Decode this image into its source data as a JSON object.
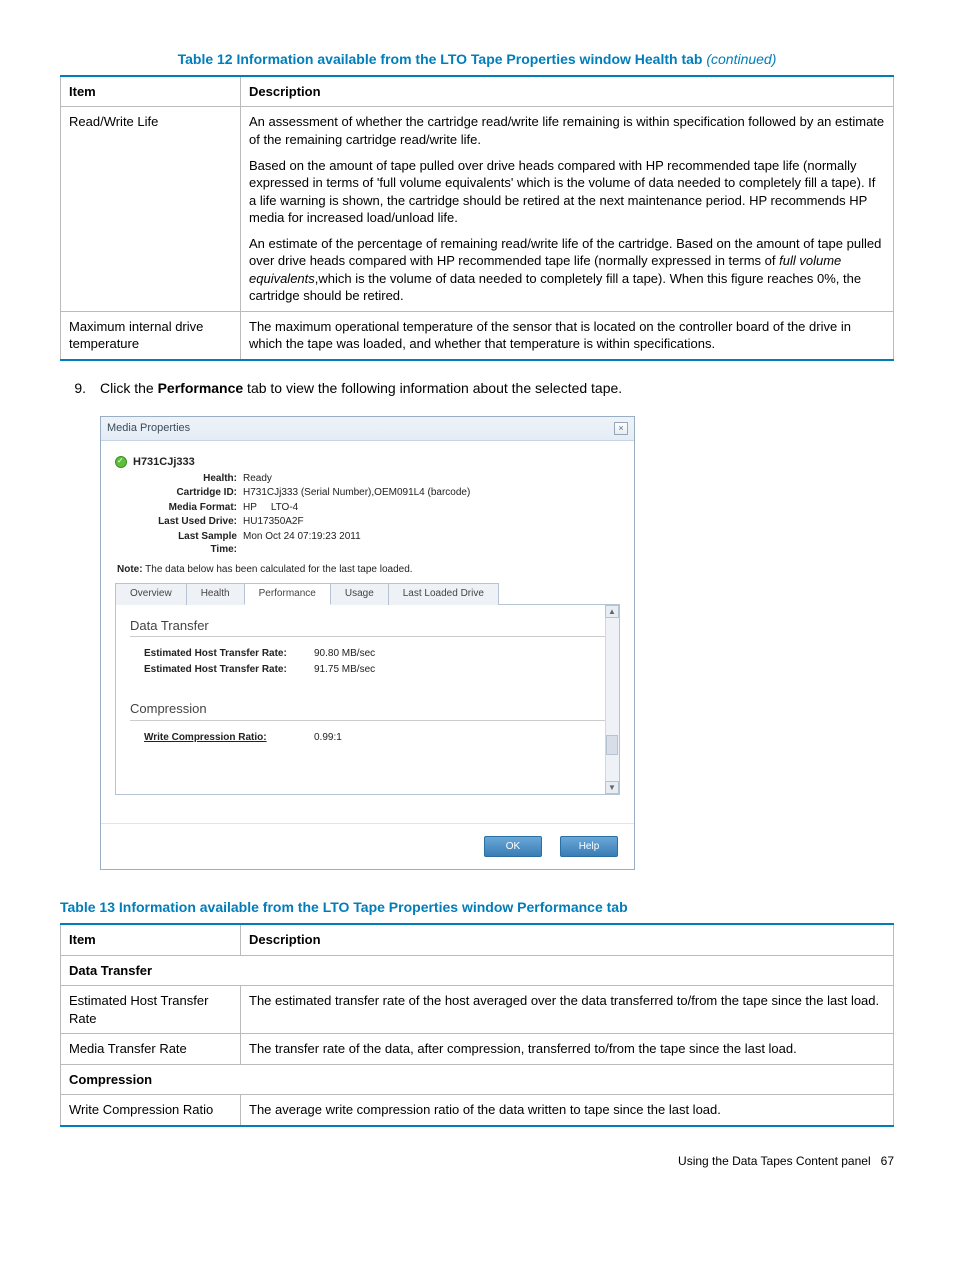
{
  "table12": {
    "caption": "Table 12 Information available from the LTO Tape Properties window Health tab",
    "continued": "(continued)",
    "headers": {
      "item": "Item",
      "desc": "Description"
    },
    "rows": [
      {
        "item": "Read/Write Life",
        "p1": "An assessment of whether the cartridge read/write life remaining is within specification followed by an estimate of the remaining cartridge read/write life.",
        "p2": "Based on the amount of tape pulled over drive heads compared with HP recommended tape life (normally expressed in terms of 'full volume equivalents' which is the volume of data needed to completely fill a tape). If a life warning is shown, the cartridge should be retired at the next maintenance period. HP recommends HP media for increased load/unload life.",
        "p3a": "An estimate of the percentage of remaining read/write life of the cartridge. Based on the amount of tape pulled over drive heads compared with HP recommended tape life (normally expressed in terms of ",
        "p3em": "full volume equivalents",
        "p3b": ",which is the volume of data needed to completely fill a tape). When this figure reaches 0%, the cartridge should be retired."
      },
      {
        "item": "Maximum internal drive temperature",
        "desc": "The maximum operational temperature of the sensor that is located on the controller board of the drive in which the tape was loaded, and whether that temperature is within specifications."
      }
    ]
  },
  "step": {
    "num": "9.",
    "before": "Click the ",
    "bold": "Performance",
    "after": " tab to view the following information about the selected tape."
  },
  "dialog": {
    "title": "Media Properties",
    "close": "×",
    "model": "H731CJj333",
    "fields": {
      "health_label": "Health:",
      "health_value": "Ready",
      "cartridge_label": "Cartridge ID:",
      "cartridge_value": "H731CJj333 (Serial Number),OEM091L4 (barcode)",
      "format_label": "Media Format:",
      "format_value_1": "HP",
      "format_value_2": "LTO-4",
      "lastdrive_label": "Last Used Drive:",
      "lastdrive_value": "HU17350A2F",
      "lastsample_label": "Last Sample Time:",
      "lastsample_value": "Mon Oct 24 07:19:23 2011"
    },
    "note_label": "Note:",
    "note_text": "The data below has been calculated for the last tape loaded.",
    "tabs": {
      "overview": "Overview",
      "health": "Health",
      "performance": "Performance",
      "usage": "Usage",
      "lastloaded": "Last Loaded Drive"
    },
    "pane": {
      "section1": "Data Transfer",
      "row1_label": "Estimated Host Transfer Rate:",
      "row1_value": "90.80 MB/sec",
      "row2_label": "Estimated Host Transfer Rate:",
      "row2_value": "91.75 MB/sec",
      "section2": "Compression",
      "row3_label": "Write Compression Ratio:",
      "row3_value": "0.99:1"
    },
    "ok": "OK",
    "help": "Help"
  },
  "table13": {
    "caption": "Table 13 Information available from the LTO Tape Properties window Performance tab",
    "headers": {
      "item": "Item",
      "desc": "Description"
    },
    "s1": "Data Transfer",
    "r1_item": "Estimated Host Transfer Rate",
    "r1_desc": "The estimated transfer rate of the host averaged over the data transferred to/from the tape since the last load.",
    "r2_item": "Media Transfer Rate",
    "r2_desc": "The transfer rate of the data, after compression, transferred to/from the tape since the last load.",
    "s2": "Compression",
    "r3_item": "Write Compression Ratio",
    "r3_desc": "The average write compression ratio of the data written to tape since the last load."
  },
  "footer": {
    "text": "Using the Data Tapes Content panel",
    "page": "67"
  },
  "chart_data": {
    "type": "table",
    "title": "Data Transfer / Compression metrics (Performance tab)",
    "rows": [
      {
        "metric": "Estimated Host Transfer Rate",
        "value": "90.80 MB/sec"
      },
      {
        "metric": "Estimated Host Transfer Rate",
        "value": "91.75 MB/sec"
      },
      {
        "metric": "Write Compression Ratio",
        "value": "0.99:1"
      }
    ]
  }
}
